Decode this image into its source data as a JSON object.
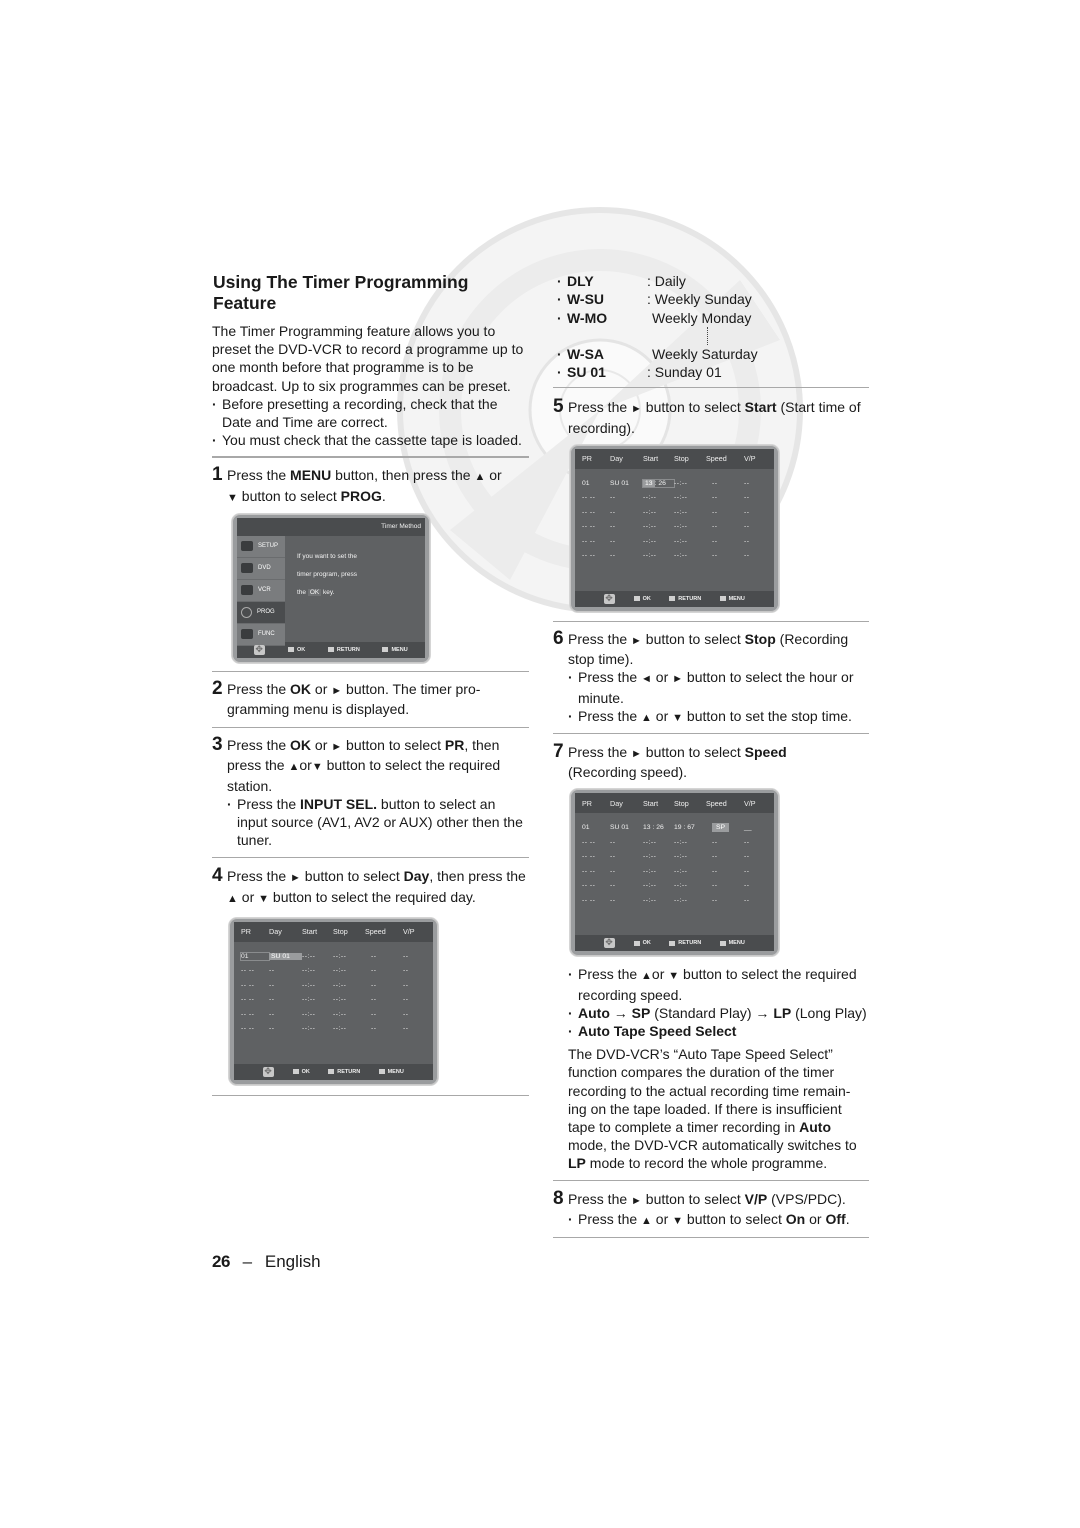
{
  "title": "Using The Timer Programming Feature",
  "intro": "The Timer Programming feature allows you to preset the DVD-VCR to record a programme up to one month before that programme is to be broadcast. Up to six programmes can be preset.",
  "intro_bullets": [
    "Before presetting a recording, check that the Date and Time are correct.",
    "You must check that the cassette tape is loaded."
  ],
  "steps": {
    "s1": {
      "num": "1",
      "a": "Press the ",
      "b1": "MENU",
      "c": " button, then press the ",
      "tri_up": "▲",
      "d": " or ",
      "tri_down": "▼",
      "e": " button to select ",
      "b2": "PROG",
      "f": "."
    },
    "s2": {
      "num": "2",
      "a": "Press the ",
      "b1": "OK",
      "c": " or ",
      "tri": "►",
      "d": " button. The timer pro-gramming menu is displayed."
    },
    "s3": {
      "num": "3",
      "a": "Press the ",
      "b1": "OK",
      "c": " or ",
      "tri": "►",
      "d": " button to select ",
      "b2": "PR",
      "e": ", then press the ",
      "tri_up": "▲",
      "f": "or",
      "tri_down": "▼",
      "g": " button to select the required station.",
      "bullet_a": "Press the ",
      "bullet_b": "INPUT SEL.",
      "bullet_c": " button to select an input source (AV1, AV2 or AUX) other then the tuner."
    },
    "s4": {
      "num": "4",
      "a": "Press the ",
      "tri": "►",
      "c": " button to select ",
      "b1": "Day",
      "d": ", then press the ",
      "tri_up": "▲",
      "e": " or ",
      "tri_down": "▼",
      "f": " button to select the required day."
    },
    "s5": {
      "num": "5",
      "a": "Press the ",
      "tri": "►",
      "c": " button to select ",
      "b1": "Start",
      "d": " (Start time of recording)."
    },
    "s6": {
      "num": "6",
      "a": "Press the ",
      "tri": "►",
      "c": " button to select ",
      "b1": "Stop",
      "d": " (Recording stop time).",
      "bullets": [
        {
          "a": "Press the ",
          "t1": "◄",
          "b": " or ",
          "t2": "►",
          "c": " button to select the hour or minute."
        },
        {
          "a": "Press the ",
          "t1": "▲",
          "b": " or ",
          "t2": "▼",
          "c": " button to set the stop time."
        }
      ]
    },
    "s7": {
      "num": "7",
      "a": "Press the ",
      "tri": "►",
      "c": " button to select ",
      "b1": "Speed",
      "d": " (Recording speed).",
      "bullet1_a": "Press the ",
      "bullet1_t1": "▲",
      "bullet1_b": "or ",
      "bullet1_t2": "▼",
      "bullet1_c": " button to select the required recording speed.",
      "bullet2_b1": "Auto",
      "bullet2_arrow": " → ",
      "bullet2_b2": "SP",
      "bullet2_mid": " (Standard Play) ",
      "bullet2_arrow2": "→ ",
      "bullet2_b3": "LP",
      "bullet2_end": " (Long Play)",
      "bullet3": "Auto Tape Speed Select",
      "para_a": "The DVD-VCR’s “Auto Tape Speed Select” function compares the duration of the timer recording to the actual recording time remain-ing on the tape loaded. If there is insufficient tape to complete a timer recording in ",
      "para_b1": "Auto",
      "para_b": " mode, the DVD-VCR automatically switches to ",
      "para_b2": "LP",
      "para_c": " mode to record the whole programme."
    },
    "s8": {
      "num": "8",
      "a": "Press the ",
      "tri": "►",
      "c": " button to select ",
      "b1": "V/P",
      "d": " (VPS/PDC).",
      "bullet_a": "Press the ",
      "bullet_t1": "▲",
      "bullet_b": " or ",
      "bullet_t2": "▼",
      "bullet_c": " button to select ",
      "bullet_b1": "On",
      "bullet_d": " or ",
      "bullet_b2": "Off",
      "bullet_e": "."
    }
  },
  "day_options": [
    {
      "code": "DLY",
      "desc": ": Daily"
    },
    {
      "code": "W-SU",
      "desc": ": Weekly Sunday"
    },
    {
      "code": "W-MO",
      "desc": "Weekly Monday"
    },
    {
      "code": "W-SA",
      "desc": "Weekly Saturday"
    },
    {
      "code": "SU 01",
      "desc": ": Sunday 01"
    }
  ],
  "menu_osd": {
    "header": "Timer Method",
    "tabs": [
      "SETUP",
      "DVD",
      "VCR",
      "PROG",
      "FUNC"
    ],
    "selected_tab": "PROG",
    "msg1": "If you want to set the",
    "msg2": "timer program, press",
    "msg3a": "the ",
    "msg3ok": "OK",
    "msg3b": " key."
  },
  "osd_footer": {
    "ok": "OK",
    "return": "RETURN",
    "menu": "MENU"
  },
  "timer_grid": {
    "headers": [
      "PR",
      "Day",
      "Start",
      "Stop",
      "Speed",
      "V/P"
    ],
    "empty_row": [
      "-- -- --",
      "",
      "--:--",
      "--:--",
      "--",
      "--"
    ],
    "screen_day": {
      "pr": "01",
      "day": "SU  01",
      "start": "--:--",
      "stop": "--:--",
      "speed": "--",
      "vp": "--"
    },
    "screen_start": {
      "pr": "01",
      "day": "SU  01",
      "start_h": "13",
      "start_m": ": 26",
      "stop": "--:--",
      "speed": "--",
      "vp": "--"
    },
    "screen_speed": {
      "pr": "01",
      "day": "SU  01",
      "start": "13 : 26",
      "stop": "19 : 67",
      "speed": "SP",
      "vp": "__"
    },
    "dash2": "-- --",
    "dash_pr": "--",
    "dash_time": "--:--",
    "dash": "--"
  },
  "footer": {
    "page": "26",
    "sep": "–",
    "lang": "English"
  }
}
